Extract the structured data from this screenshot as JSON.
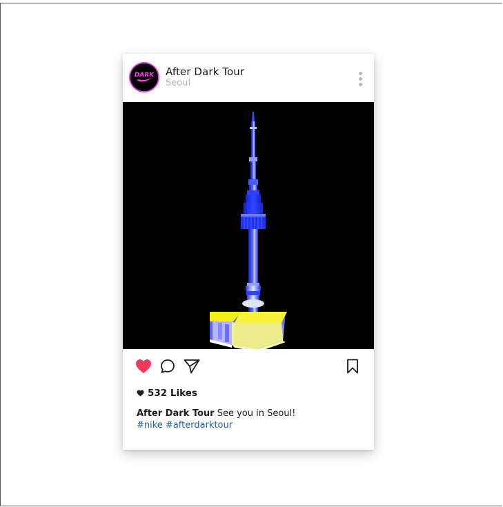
{
  "post": {
    "account_name": "After Dark Tour",
    "location": "Seoul",
    "avatar_text": "DARK",
    "likes": "532 Likes",
    "caption_author": "After Dark Tour",
    "caption_text": " See you in Seoul!",
    "hashtags": [
      "#nike",
      "#afterdarktour"
    ],
    "liked": true
  },
  "icons": {
    "menu": "more-vertical-icon",
    "like": "heart-icon",
    "comment": "comment-icon",
    "share": "send-icon",
    "save": "bookmark-icon"
  },
  "colors": {
    "heart": "#f0395e",
    "avatar_ring": "#e63fe6",
    "hashtag": "#1d5fa8",
    "tower_blue": "#1a2cf0",
    "tower_yellow": "#f4f01c"
  }
}
